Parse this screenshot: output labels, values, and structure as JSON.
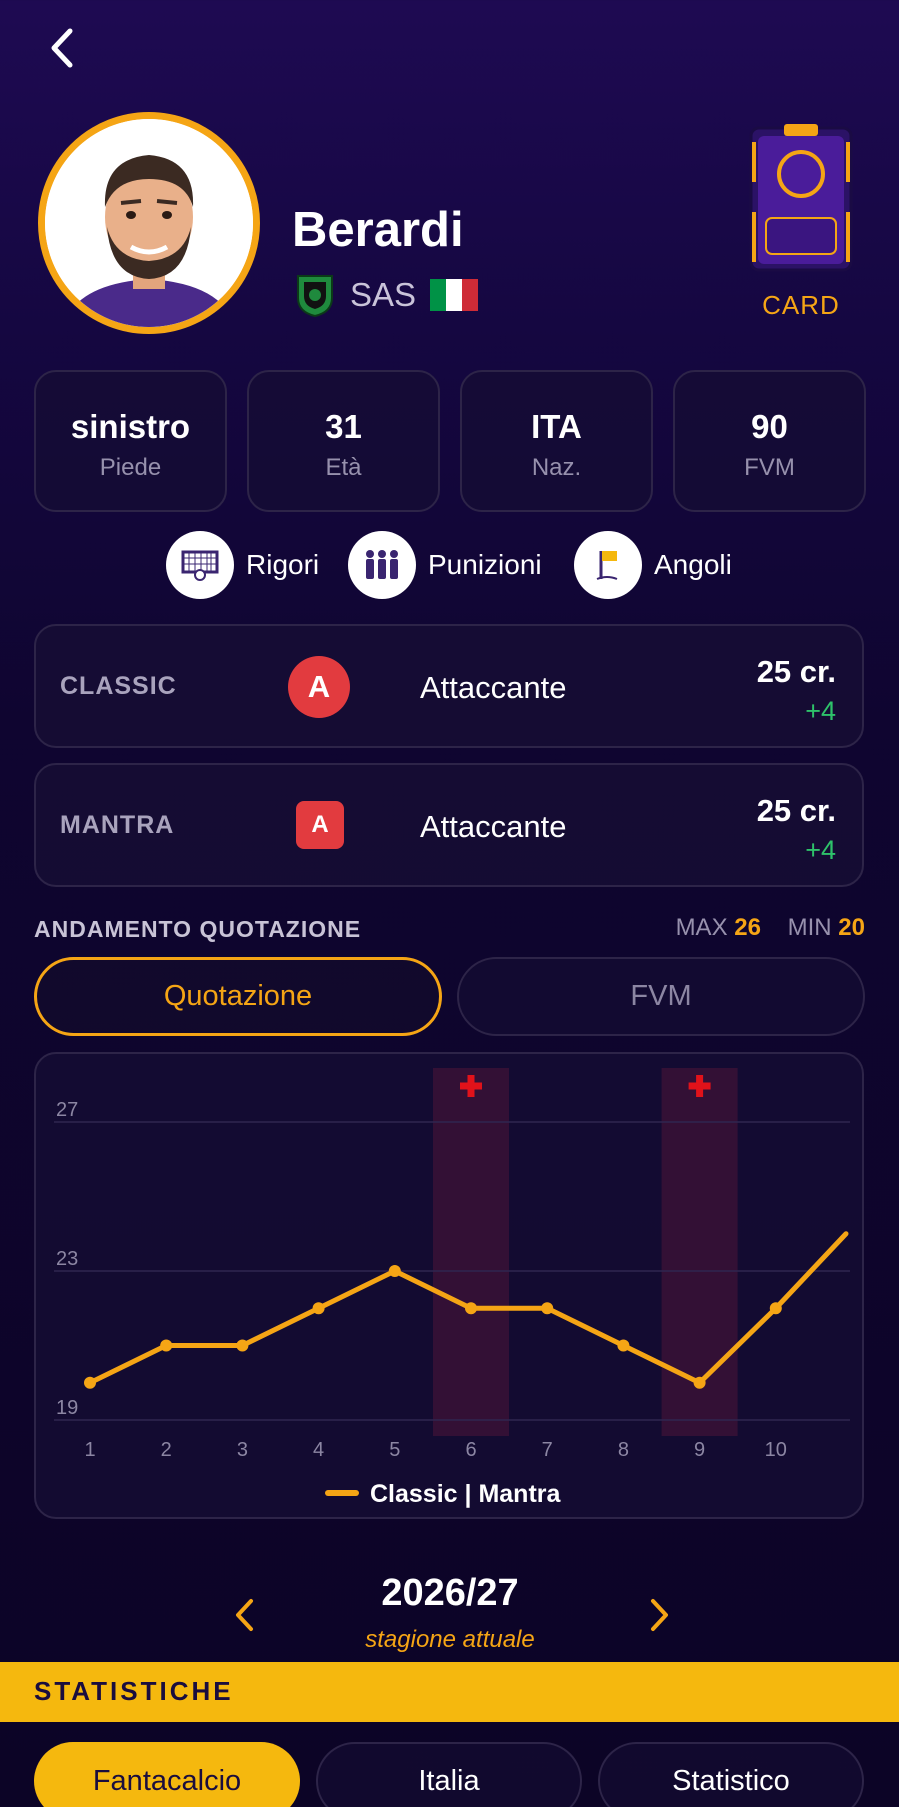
{
  "header": {
    "back_icon": "chevron-left-icon"
  },
  "player": {
    "name": "Berardi",
    "team_code": "SAS",
    "team_icon": "sassuolo-crest-icon",
    "flag_colors": [
      "#009246",
      "#ffffff",
      "#ce2b37"
    ]
  },
  "card": {
    "label": "CARD"
  },
  "info": [
    {
      "value": "sinistro",
      "label": "Piede"
    },
    {
      "value": "31",
      "label": "Età"
    },
    {
      "value": "ITA",
      "label": "Naz."
    },
    {
      "value": "90",
      "label": "FVM"
    }
  ],
  "skills": [
    {
      "label": "Rigori",
      "icon": "penalty-goal-icon"
    },
    {
      "label": "Punizioni",
      "icon": "free-kick-wall-icon"
    },
    {
      "label": "Angoli",
      "icon": "corner-flag-icon"
    }
  ],
  "roles": [
    {
      "mode": "CLASSIC",
      "badge": "A",
      "role": "Attaccante",
      "credits": "25 cr.",
      "delta": "+4"
    },
    {
      "mode": "MANTRA",
      "badge": "A",
      "role": "Attaccante",
      "credits": "25 cr.",
      "delta": "+4"
    }
  ],
  "trend": {
    "title": "ANDAMENTO QUOTAZIONE",
    "max_label": "MAX",
    "max_value": "26",
    "min_label": "MIN",
    "min_value": "20",
    "toggle_active": "Quotazione",
    "toggle_inactive": "FVM"
  },
  "chart_data": {
    "type": "line",
    "x": [
      1,
      2,
      3,
      4,
      5,
      6,
      7,
      8,
      9,
      10
    ],
    "series": [
      {
        "name": "Classic | Mantra",
        "values": [
          20,
          21,
          21,
          22,
          23,
          22,
          22,
          21,
          20,
          22
        ],
        "color": "#f5a515"
      }
    ],
    "trailing_value": 24,
    "y_ticks": [
      19,
      23,
      27
    ],
    "ylim": [
      19,
      28
    ],
    "injury_matchdays": [
      6,
      9
    ],
    "injury_icon": "red-cross-icon",
    "grid": true,
    "legend": "bottom-center"
  },
  "season": {
    "year": "2026/27",
    "subtitle": "stagione attuale",
    "prev_icon": "chevron-left-icon",
    "next_icon": "chevron-right-icon"
  },
  "stats": {
    "title": "STATISTICHE",
    "tabs": [
      "Fantacalcio",
      "Italia",
      "Statistico"
    ]
  },
  "colors": {
    "accent": "#f5a515",
    "positive": "#2ec26a",
    "role_badge": "#e23b3f",
    "injury": "#e1121a"
  }
}
